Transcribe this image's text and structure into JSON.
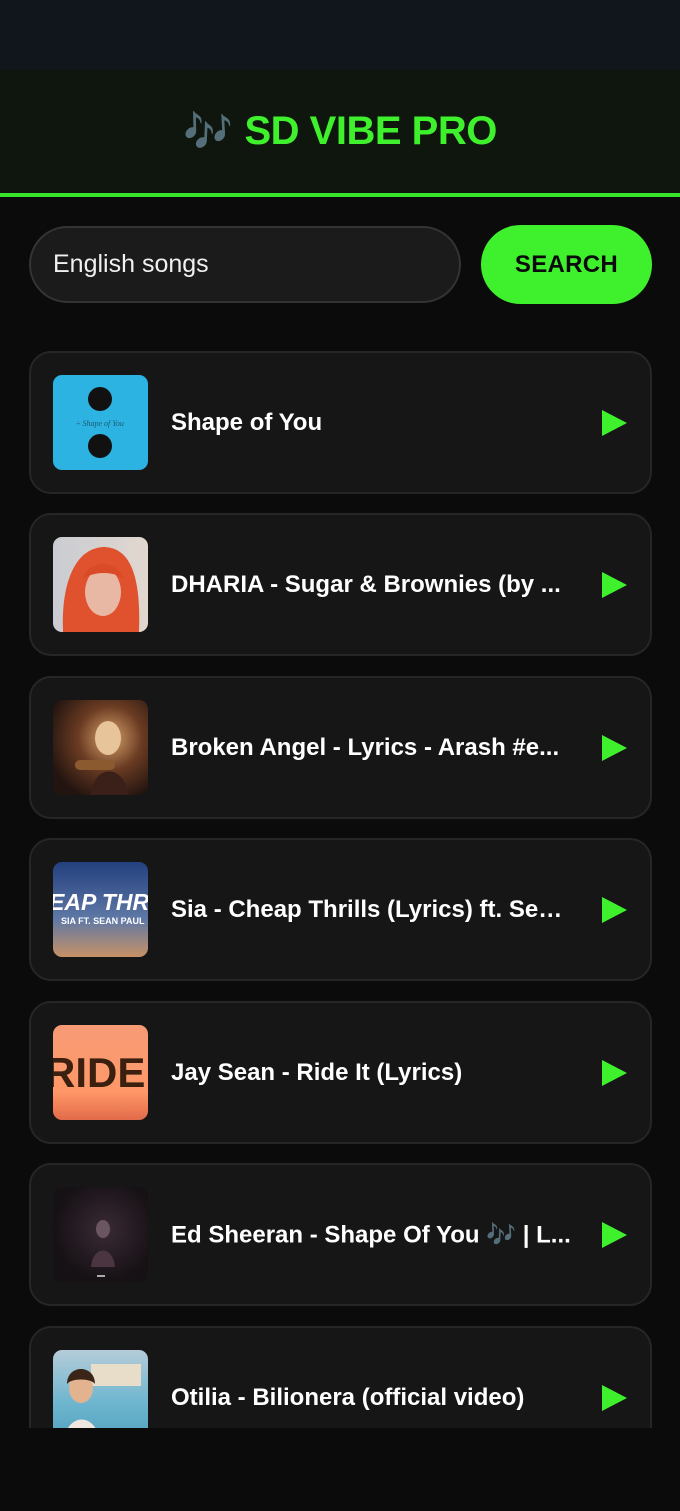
{
  "app": {
    "title": "SD VIBE PRO",
    "title_icon": "🎶",
    "accent_color": "#3ff02d"
  },
  "search": {
    "value": "English songs",
    "button_label": "SEARCH"
  },
  "songs": [
    {
      "title": "Shape of You",
      "thumb_text": "÷  Shape of You"
    },
    {
      "title": "DHARIA - Sugar & Brownies (by ..."
    },
    {
      "title": "Broken Angel - Lyrics - Arash #e..."
    },
    {
      "title": "Sia - Cheap Thrills (Lyrics) ft. Sea...",
      "thumb_text": "EAP THRIL",
      "thumb_subtext": "SIA FT. SEAN PAUL"
    },
    {
      "title": "Jay Sean - Ride It (Lyrics)",
      "thumb_text": "RIDE IT"
    },
    {
      "title": "Ed Sheeran - Shape Of You 🎶 | L..."
    },
    {
      "title": "Otilia - Bilionera (official video)"
    }
  ]
}
